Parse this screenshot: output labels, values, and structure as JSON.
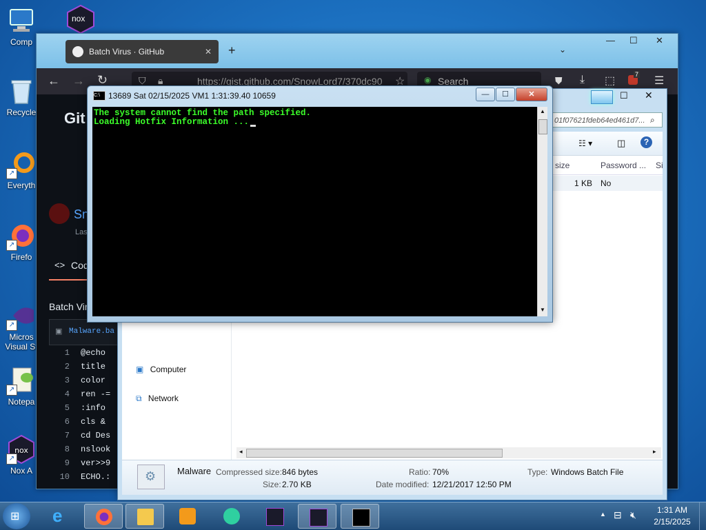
{
  "desktop": {
    "icons": [
      {
        "label": "Comp",
        "icon": "computer-icon"
      },
      {
        "label": "Recycle",
        "icon": "recycle-bin-icon"
      },
      {
        "label": "Everyth",
        "icon": "everything-icon"
      },
      {
        "label": "Firefo",
        "icon": "firefox-icon"
      },
      {
        "label": "Micros Visual St",
        "icon": "visual-studio-icon"
      },
      {
        "label": "Notepa",
        "icon": "notepad-plus-icon"
      },
      {
        "label": "Nox A",
        "icon": "nox-icon"
      }
    ],
    "nox_top_label": "nox"
  },
  "firefox": {
    "tab_title": "Batch Virus · GitHub",
    "url": "https://gist.github.com/SnowLord7/370dc90",
    "search_placeholder": "Search",
    "badge_count": "7",
    "page": {
      "brand": "Git",
      "user_partial": "Sn",
      "last_partial": "Las",
      "code_tab": "Cod",
      "gist_title_partial": "Batch Vir",
      "file_partial": "Malware.ba",
      "code_lines": [
        {
          "n": "1",
          "c": "@echo"
        },
        {
          "n": "2",
          "c": "title"
        },
        {
          "n": "3",
          "c": "color"
        },
        {
          "n": "4",
          "c": "ren -="
        },
        {
          "n": "5",
          "c": ":info"
        },
        {
          "n": "6",
          "c": "cls &"
        },
        {
          "n": "7",
          "c": "cd Des"
        },
        {
          "n": "8",
          "c": "nslook"
        },
        {
          "n": "9",
          "c": "ver>>9"
        },
        {
          "n": "10",
          "c": "ECHO.:"
        }
      ]
    }
  },
  "explorer": {
    "address_partial": "01f07621fdeb64ed461d7...",
    "columns": [
      "d size",
      "Password ...",
      "Si"
    ],
    "row": {
      "size": "1 KB",
      "password": "No"
    },
    "nav": [
      {
        "label": "Computer",
        "icon": "computer-icon"
      },
      {
        "label": "Network",
        "icon": "network-icon"
      }
    ],
    "details": {
      "name": "Malware",
      "compressed_label": "Compressed size:",
      "compressed_value": "846 bytes",
      "size_label": "Size:",
      "size_value": "2.70 KB",
      "ratio_label": "Ratio:",
      "ratio_value": "70%",
      "date_label": "Date modified:",
      "date_value": "12/21/2017 12:50 PM",
      "type_label": "Type:",
      "type_value": "Windows Batch File"
    }
  },
  "cmd": {
    "title": "13689 Sat 02/15/2025 VM1  1:31:39.40 10659",
    "lines": [
      "The system cannot find the path specified.",
      "Loading Hotfix Information ..."
    ]
  },
  "taskbar": {
    "time": "1:31 AM",
    "date": "2/15/2025",
    "items": [
      "start",
      "ie",
      "firefox",
      "explorer",
      "media-player",
      "app",
      "nox",
      "nox-active",
      "cmd"
    ]
  },
  "colors": {
    "cmd_text": "#3cff2a",
    "desktop": "#1b6fbf",
    "github_bg": "#0d1117"
  }
}
